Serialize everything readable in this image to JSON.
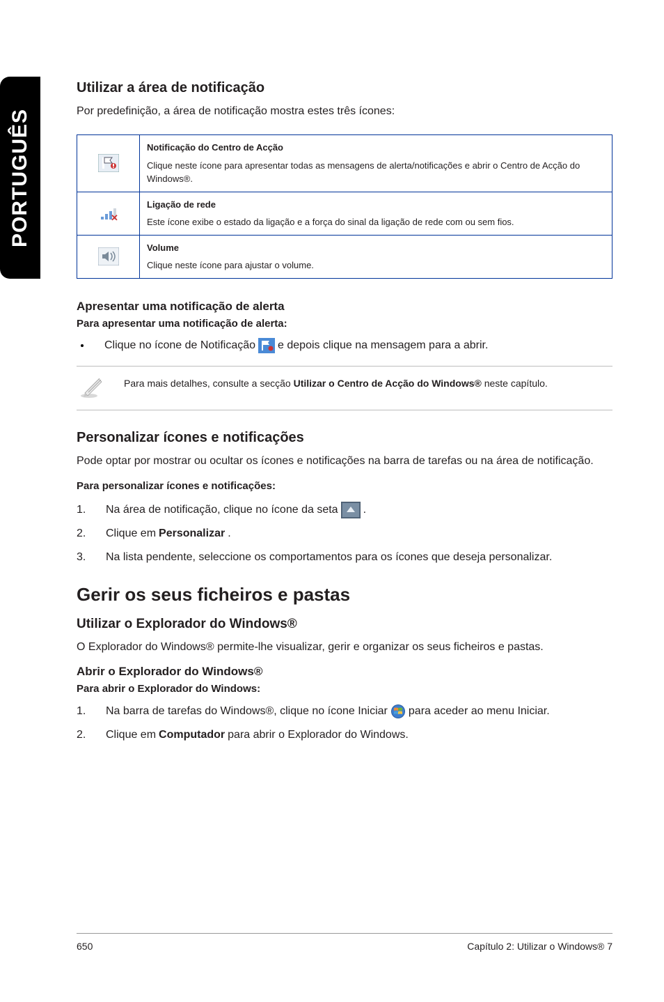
{
  "sidebar": {
    "language": "PORTUGUÊS"
  },
  "section1": {
    "heading": "Utilizar a área de notificação",
    "intro": "Por predefinição, a área de notificação mostra estes três ícones:"
  },
  "table": {
    "rows": [
      {
        "icon": "flag-icon",
        "title": "Notificação do Centro de Acção",
        "desc": "Clique neste ícone para apresentar todas as mensagens de alerta/notificações e abrir o Centro de Acção do Windows®."
      },
      {
        "icon": "network-icon",
        "title": "Ligação de rede",
        "desc": "Este ícone exibe o estado da ligação e a força do sinal da ligação de rede com ou sem fios."
      },
      {
        "icon": "volume-icon",
        "title": "Volume",
        "desc": "Clique neste ícone para ajustar o volume."
      }
    ]
  },
  "alert": {
    "heading": "Apresentar uma notificação de alerta",
    "sub": "Para apresentar uma notificação de alerta:",
    "bullet_before": "Clique no ícone de Notificação",
    "bullet_after": "e depois clique na mensagem para a abrir."
  },
  "note": {
    "text_before": "Para mais detalhes, consulte a secção ",
    "text_bold": "Utilizar o Centro de Acção do Windows®",
    "text_after": " neste capítulo."
  },
  "personalize": {
    "heading": "Personalizar ícones e notificações",
    "intro": "Pode optar por mostrar ou ocultar os ícones e notificações na barra de tarefas ou na área de notificação.",
    "sub": "Para personalizar ícones e notificações:",
    "steps": [
      {
        "before": "Na área de notificação, clique no ícone da seta",
        "after": "."
      },
      {
        "before": "Clique em ",
        "bold": "Personalizar",
        "after": "."
      },
      {
        "before": "Na lista pendente, seleccione os comportamentos para os ícones que deseja personalizar."
      }
    ]
  },
  "manage": {
    "heading": "Gerir os seus ficheiros e pastas",
    "sub1": "Utilizar o Explorador do Windows®",
    "intro": "O Explorador do Windows® permite-lhe visualizar, gerir e organizar os seus ficheiros e pastas.",
    "sub2": "Abrir o Explorador do Windows®",
    "sub3": "Para abrir o Explorador do Windows:",
    "steps": [
      {
        "before": "Na barra de tarefas do Windows®, clique no ícone Iniciar",
        "after": "para aceder ao menu Iniciar."
      },
      {
        "before": "Clique em ",
        "bold": "Computador",
        "after": " para abrir o Explorador do Windows."
      }
    ]
  },
  "footer": {
    "page": "650",
    "chapter": "Capítulo 2: Utilizar o Windows® 7"
  }
}
